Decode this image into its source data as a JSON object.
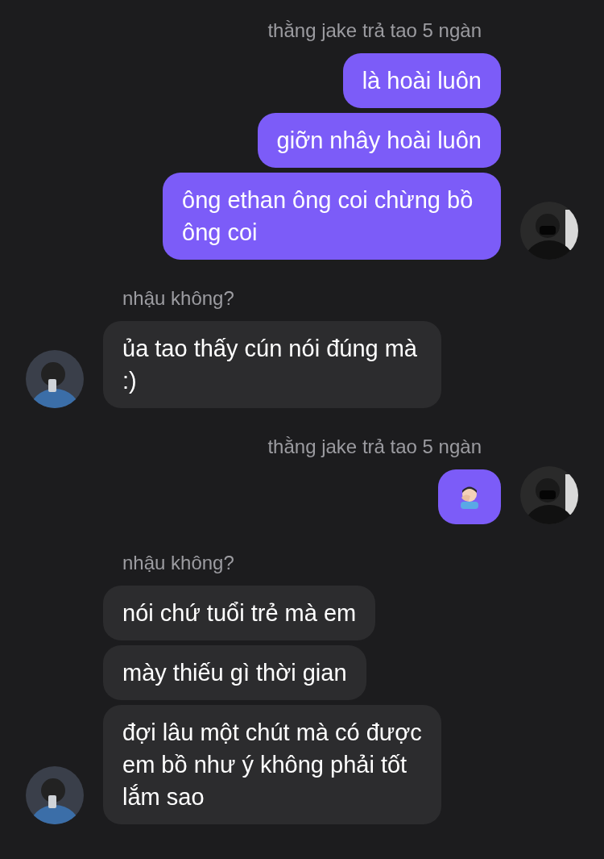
{
  "groups": [
    {
      "kind": "outgoing",
      "sender": "thằng jake trả tao 5 ngàn",
      "messages": [
        {
          "kind": "text",
          "text": "là hoài luôn"
        },
        {
          "kind": "text",
          "text": "giỡn nhây hoài luôn"
        },
        {
          "kind": "text",
          "text": "ông ethan ông coi chừng bồ ông coi"
        }
      ]
    },
    {
      "kind": "incoming",
      "sender": "nhậu không?",
      "messages": [
        {
          "kind": "text",
          "text": "ủa tao thấy cún nói đúng mà :)"
        }
      ]
    },
    {
      "kind": "outgoing",
      "sender": "thằng jake trả tao 5 ngàn",
      "messages": [
        {
          "kind": "emoji"
        }
      ]
    },
    {
      "kind": "incoming",
      "sender": "nhậu không?",
      "messages": [
        {
          "kind": "text",
          "text": "nói chứ tuổi trẻ mà em"
        },
        {
          "kind": "text",
          "text": "mày thiếu gì thời gian"
        },
        {
          "kind": "text",
          "text": "đợi lâu một chút mà có được em bồ như ý không phải tốt lắm sao"
        }
      ]
    }
  ]
}
